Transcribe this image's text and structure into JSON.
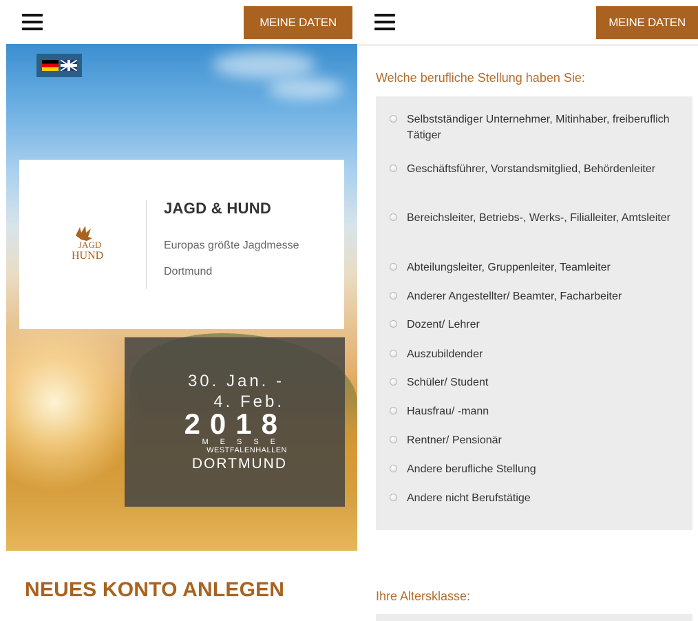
{
  "left": {
    "menu_icon": "hamburger-icon",
    "meine_daten": "MEINE DATEN",
    "languages": [
      "Deutsch",
      "English"
    ],
    "event": {
      "title": "JAGD & HUND",
      "subtitle": "Europas größte Jagdmesse",
      "city": "Dortmund",
      "logo_line1": "JAGD",
      "logo_line2": "HUND"
    },
    "dates": {
      "line1": "30. Jan. -",
      "line2": "4. Feb.",
      "year": "2018",
      "messe": "MESSE",
      "venue": "WESTFALENHALLEN",
      "city": "DORTMUND"
    },
    "heading": "NEUES KONTO ANLEGEN"
  },
  "right": {
    "menu_icon": "hamburger-icon",
    "meine_daten": "MEINE DATEN",
    "question": "Welche berufliche Stellung haben Sie:",
    "options": [
      "Selbstständiger Unternehmer, Mitinhaber, freiberuflich Tätiger",
      "Geschäftsführer, Vorstandsmitglied, Behördenleiter",
      "Bereichsleiter, Betriebs-, Werks-, Filialleiter, Amtsleiter",
      "Abteilungsleiter, Gruppenleiter, Teamleiter",
      "Anderer Angestellter/ Beamter, Facharbeiter",
      "Dozent/ Lehrer",
      "Auszubildender",
      "Schüler/ Student",
      "Hausfrau/ -mann",
      "Rentner/ Pensionär",
      "Andere berufliche Stellung",
      "Andere nicht Berufstätige"
    ],
    "age_question": "Ihre Altersklasse:"
  },
  "colors": {
    "brand_brown": "#a9621f",
    "label_brown": "#b26e2d",
    "option_bg": "#ececec"
  }
}
